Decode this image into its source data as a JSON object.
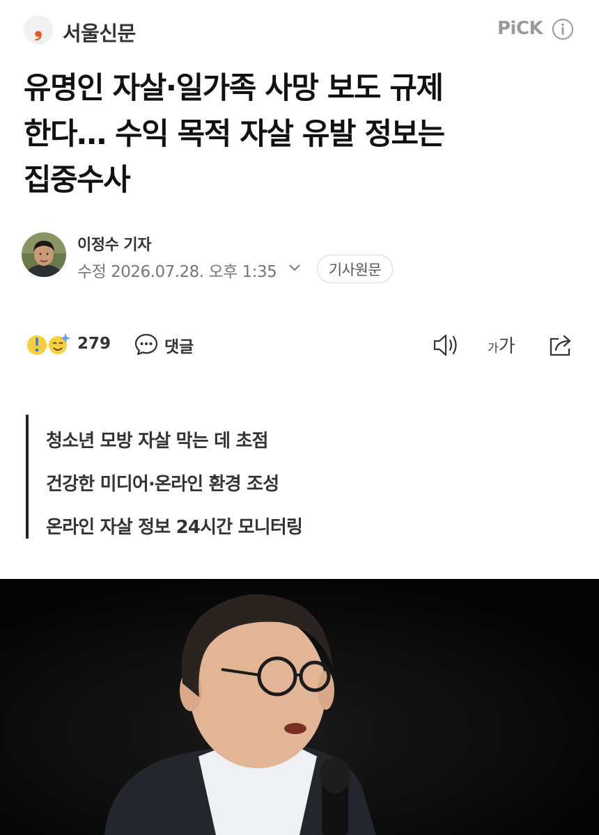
{
  "header": {
    "press_name": "서울신문",
    "press_logo_glyph": "❟",
    "press_logo_color": "#e8591f",
    "pick_label": "PiCK",
    "info_icon": "info-icon"
  },
  "article": {
    "headline_lines": [
      "유명인 자살·일가족 사망 보도 규제",
      "한다… 수익 목적 자살 유발 정보는",
      "집중수사"
    ],
    "reporter": "이정수 기자",
    "date": "수정 2026.07.28. 오후 1:35",
    "original_button": "기사원문"
  },
  "actions": {
    "reaction_count": "279",
    "comment_label": "댓글",
    "font_size_small": "가",
    "font_size_large": "가",
    "icons": [
      "reaction-icon",
      "comment-icon",
      "speaker-icon",
      "font-size-icon",
      "share-icon"
    ]
  },
  "summary": {
    "lines": [
      "청소년 모방 자살 막는 데 초점",
      "건강한 미디어·온라인 환경 조성",
      "온라인 자살 정보 24시간 모니터링"
    ]
  },
  "colors": {
    "brand": "#e8591f",
    "text": "#111111",
    "muted": "#777777"
  }
}
